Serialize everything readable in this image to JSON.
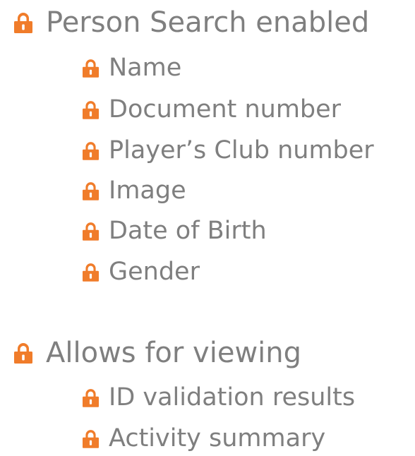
{
  "colors": {
    "lock": "#f07c2a",
    "text": "#7f7f7f"
  },
  "icons": {
    "bullet": "padlock-icon"
  },
  "sections": [
    {
      "heading": "Person Search enabled",
      "items": [
        "Name",
        "Document number",
        "Player’s Club number",
        "Image",
        "Date of Birth",
        "Gender"
      ]
    },
    {
      "heading": "Allows for viewing",
      "items": [
        "ID validation results",
        "Activity summary"
      ]
    }
  ]
}
